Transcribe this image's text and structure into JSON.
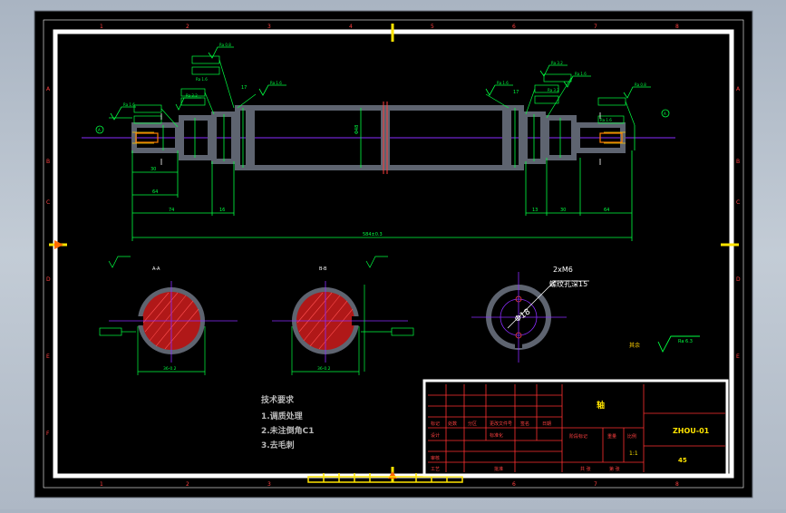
{
  "drawing": {
    "grid_cols": [
      "1",
      "2",
      "3",
      "4",
      "5",
      "6",
      "7",
      "8"
    ],
    "grid_rows": [
      "A",
      "B",
      "C",
      "D",
      "E",
      "F"
    ],
    "dimensions": {
      "overall": "584±0.3",
      "left_30": "30",
      "left_64": "64",
      "left_74": "74",
      "left_16": "16",
      "right_13": "13",
      "right_30": "30",
      "right_64": "64",
      "right_17": "17",
      "left_17": "17",
      "center_dia": "Φ48"
    },
    "roughness": {
      "r1": "Ra 1.6",
      "r2": "Ra 3.2",
      "r3": "Ra 0.8",
      "r4": "Ra 1.6",
      "r5": "Ra 1.6",
      "r6": "Ra 3.2",
      "r7": "Ra 1.6",
      "r8": "Ra 0.8",
      "r9": "Ra 1.6",
      "r10": "Ra 3.2",
      "r11": "Ra 1.6"
    },
    "datum_a": "A",
    "section_labels": {
      "aa": "A-A",
      "bb": "B-B"
    },
    "section_aa_dim": "36-0.2",
    "section_bb_dim": "36-0.2",
    "end_view": {
      "thread": "2xM6",
      "depth_note": "螺纹孔深15",
      "dia": "Φ18"
    },
    "remaining_note": "其余",
    "remaining_ra": "Ra 6.3",
    "tech_req": {
      "title": "技术要求",
      "l1": "1.调质处理",
      "l2": "2.未注倒角C1",
      "l3": "3.去毛刺"
    }
  },
  "title_block": {
    "headers": [
      "标记",
      "处数",
      "分区",
      "更改文件号",
      "签名",
      "日期"
    ],
    "design": "设计",
    "standard": "标准化",
    "review": "审核",
    "process": "工艺",
    "approve": "批准",
    "stage_label": "阶段标记",
    "weight_label": "重量",
    "scale_label": "比例",
    "scale_value": "1:1",
    "sheets": "共 张",
    "sheet_of": "第 张",
    "name": "轴",
    "code": "ZHOU-01",
    "material": "45"
  }
}
